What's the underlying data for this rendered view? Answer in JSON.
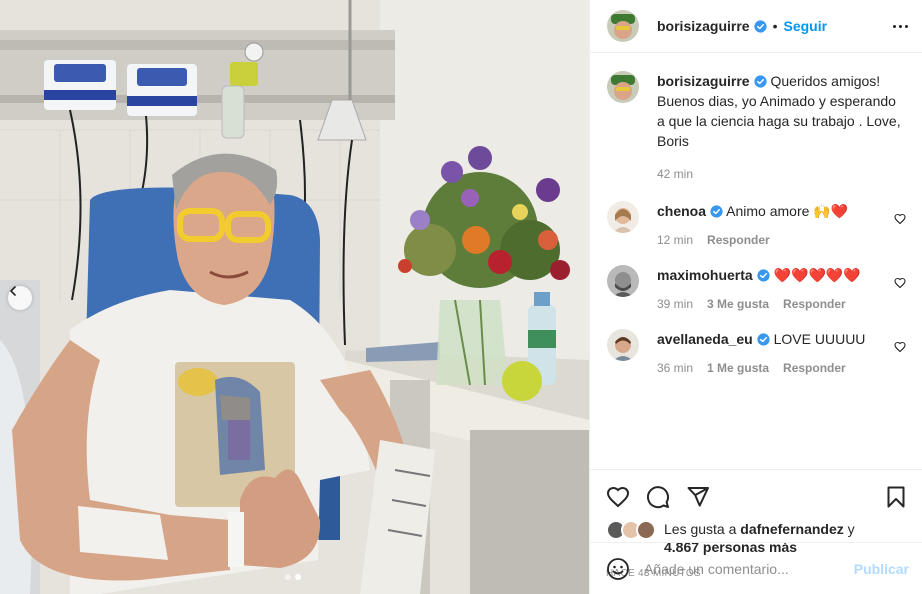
{
  "post": {
    "author": "borisizaguirre",
    "follow_label": "Seguir",
    "separator": "•",
    "more_icon": "more-horizontal-icon"
  },
  "caption": {
    "username": "borisizaguirre",
    "text": "Queridos amigos! Buenos dias, yo Animado y esperando a que la ciencia haga su trabajo . Love, Boris",
    "time": "42 min"
  },
  "comments": [
    {
      "username": "chenoa",
      "text": "Animo amore 🙌❤️",
      "time": "12 min",
      "likes": "",
      "reply": "Responder"
    },
    {
      "username": "maximohuerta",
      "text": "❤️❤️❤️❤️❤️",
      "time": "39 min",
      "likes": "3 Me gusta",
      "reply": "Responder"
    },
    {
      "username": "avellaneda_eu",
      "text": "LOVE UUUUU",
      "time": "36 min",
      "likes": "1 Me gusta",
      "reply": "Responder"
    }
  ],
  "likes": {
    "prefix": "Les gusta a",
    "user": "dafnefernandez",
    "conj": "y",
    "count": "4.867 personas más"
  },
  "time_ago": "Hace 43 minutos",
  "comment_box": {
    "placeholder": "Añade un comentario...",
    "publish_label": "Publicar"
  },
  "carousel": {
    "count": 2,
    "active": 1
  },
  "colors": {
    "accent": "#0095f6",
    "verified": "#3897f0",
    "publish_disabled": "#b3dbff",
    "muted": "#8e8e8e"
  }
}
